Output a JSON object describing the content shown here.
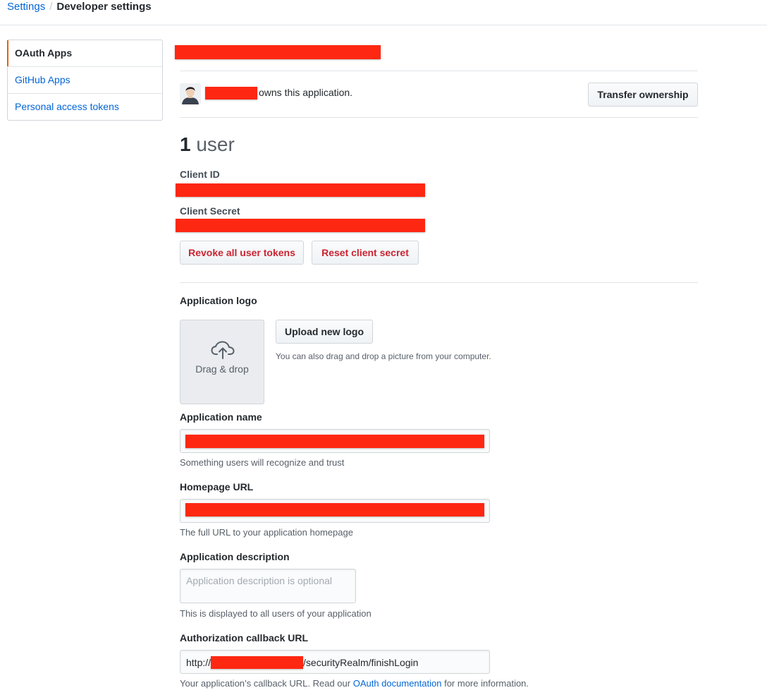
{
  "breadcrumb": {
    "root": "Settings",
    "separator": "/",
    "current": "Developer settings"
  },
  "sidebar": {
    "items": [
      {
        "label": "OAuth Apps"
      },
      {
        "label": "GitHub Apps"
      },
      {
        "label": "Personal access tokens"
      }
    ]
  },
  "owner": {
    "suffix": "owns this application.",
    "transfer_label": "Transfer ownership"
  },
  "users": {
    "count": "1",
    "unit": "user"
  },
  "credentials": {
    "client_id_label": "Client ID",
    "client_secret_label": "Client Secret",
    "revoke_label": "Revoke all user tokens",
    "reset_label": "Reset client secret"
  },
  "logo": {
    "label": "Application logo",
    "drop_text": "Drag & drop",
    "upload_label": "Upload new logo",
    "hint": "You can also drag and drop a picture from your computer."
  },
  "form": {
    "name_label": "Application name",
    "name_help": "Something users will recognize and trust",
    "homepage_label": "Homepage URL",
    "homepage_help": "The full URL to your application homepage",
    "description_label": "Application description",
    "description_placeholder": "Application description is optional",
    "description_help": "This is displayed to all users of your application",
    "callback_label": "Authorization callback URL",
    "callback_prefix": "http://",
    "callback_suffix": "/securityRealm/finishLogin",
    "callback_help_before": "Your application’s callback URL. Read our",
    "callback_help_link": "OAuth documentation",
    "callback_help_after": "for more information."
  },
  "colors": {
    "link": "#0366d6",
    "danger": "#cb2431",
    "redaction": "#fe2712",
    "selected_accent": "#e36209"
  }
}
